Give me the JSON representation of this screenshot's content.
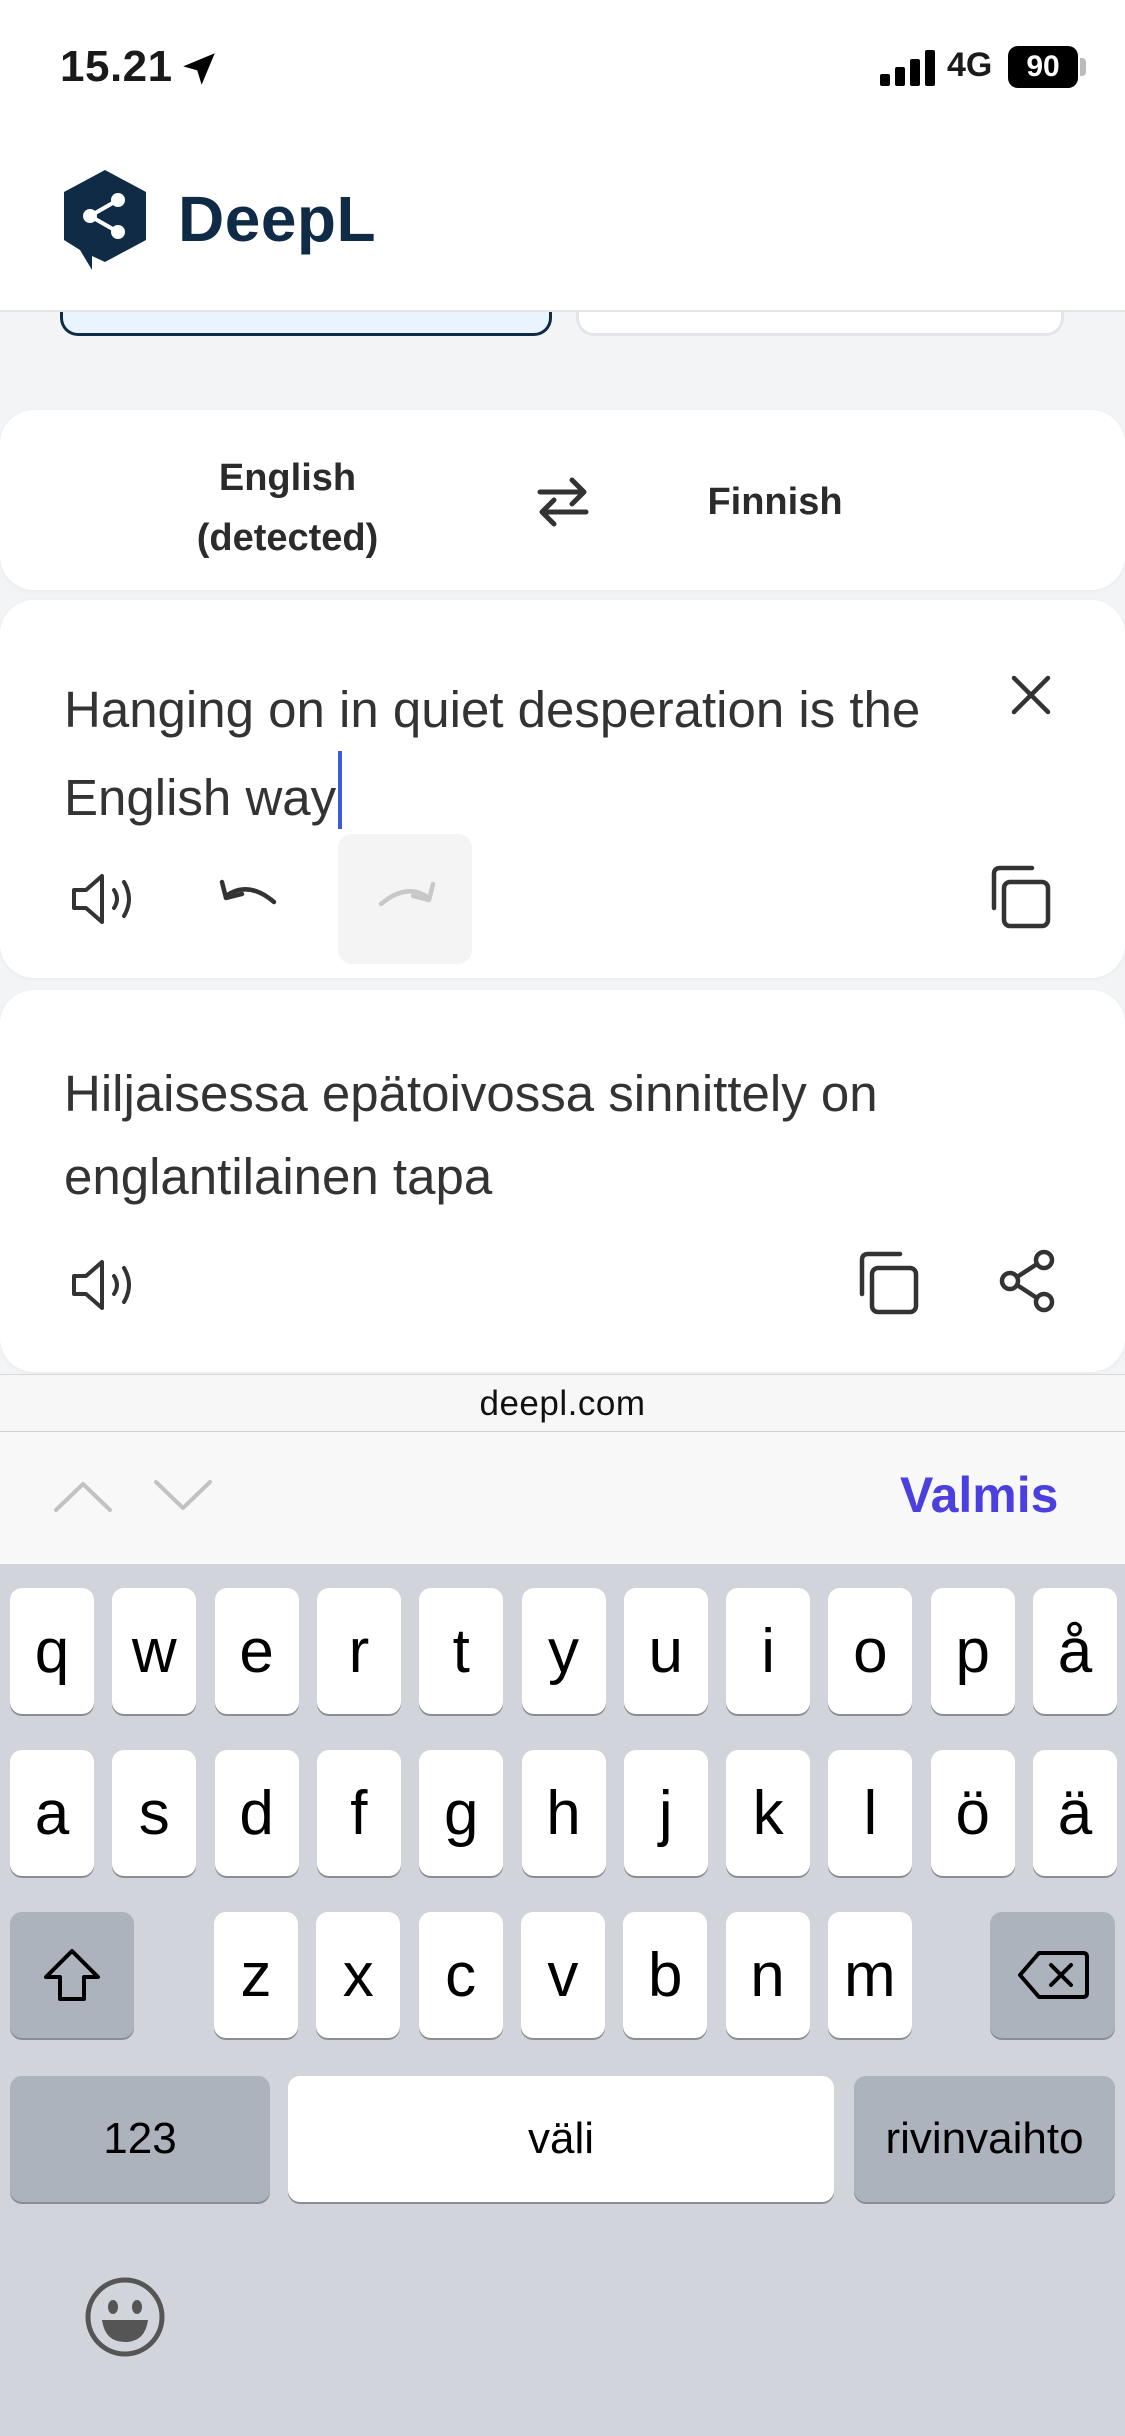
{
  "status_bar": {
    "time": "15.21",
    "network": "4G",
    "battery": "90"
  },
  "header": {
    "brand": "DeepL"
  },
  "languages": {
    "source": "English (detected)",
    "target": "Finnish"
  },
  "source": {
    "text": "Hanging on in quiet desperation is the English way"
  },
  "translation": {
    "text": "Hiljaisessa epätoivossa sinnittely on englantilainen tapa"
  },
  "url_bar": {
    "domain": "deepl.com"
  },
  "accessory": {
    "done_label": "Valmis"
  },
  "keyboard": {
    "row1": [
      "q",
      "w",
      "e",
      "r",
      "t",
      "y",
      "u",
      "i",
      "o",
      "p",
      "å"
    ],
    "row2": [
      "a",
      "s",
      "d",
      "f",
      "g",
      "h",
      "j",
      "k",
      "l",
      "ö",
      "ä"
    ],
    "row3": [
      "z",
      "x",
      "c",
      "v",
      "b",
      "n",
      "m"
    ],
    "numbers_label": "123",
    "space_label": "väli",
    "return_label": "rivinvaihto"
  },
  "colors": {
    "brand": "#0f2b46",
    "accent": "#4b3fe0",
    "caret": "#3b5bdb"
  }
}
